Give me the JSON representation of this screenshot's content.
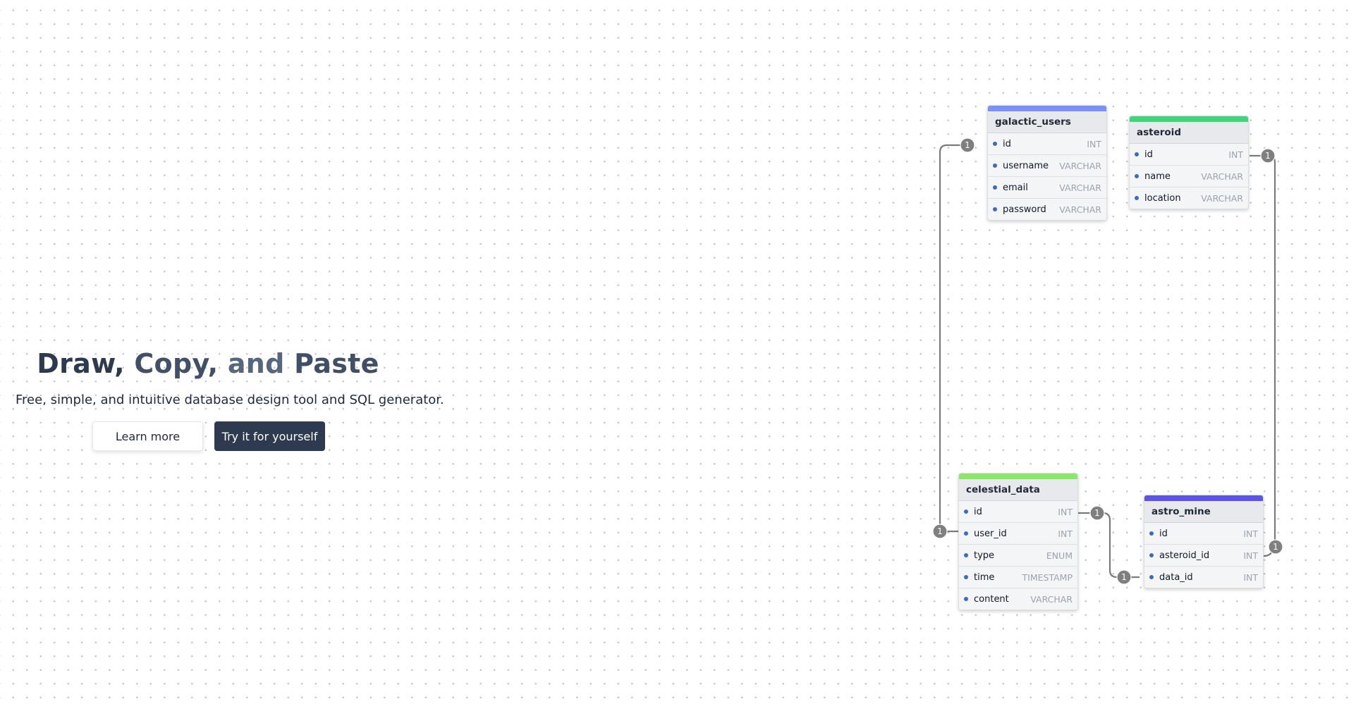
{
  "hero": {
    "title_words": [
      "Draw,",
      "Copy,",
      "and",
      "Paste"
    ],
    "title_colors": [
      "#2b3a4e",
      "#3f5068",
      "#56667c",
      "#3f4f66"
    ],
    "subtitle": "Free, simple, and intuitive database design tool and SQL generator.",
    "learn_more_label": "Learn more",
    "try_label": "Try it for yourself"
  },
  "tables": {
    "galactic_users": {
      "name": "galactic_users",
      "color": "#7b8ff8",
      "fields": [
        {
          "name": "id",
          "type": "INT"
        },
        {
          "name": "username",
          "type": "VARCHAR"
        },
        {
          "name": "email",
          "type": "VARCHAR"
        },
        {
          "name": "password",
          "type": "VARCHAR"
        }
      ]
    },
    "asteroid": {
      "name": "asteroid",
      "color": "#3ed67a",
      "fields": [
        {
          "name": "id",
          "type": "INT"
        },
        {
          "name": "name",
          "type": "VARCHAR"
        },
        {
          "name": "location",
          "type": "VARCHAR"
        }
      ]
    },
    "celestial_data": {
      "name": "celestial_data",
      "color": "#8de56c",
      "fields": [
        {
          "name": "id",
          "type": "INT"
        },
        {
          "name": "user_id",
          "type": "INT"
        },
        {
          "name": "type",
          "type": "ENUM"
        },
        {
          "name": "time",
          "type": "TIMESTAMP"
        },
        {
          "name": "content",
          "type": "VARCHAR"
        }
      ]
    },
    "astro_mine": {
      "name": "astro_mine",
      "color": "#5b53ea",
      "fields": [
        {
          "name": "id",
          "type": "INT"
        },
        {
          "name": "asteroid_id",
          "type": "INT"
        },
        {
          "name": "data_id",
          "type": "INT"
        }
      ]
    }
  },
  "relationship_labels": {
    "users_id": "1",
    "celestial_user_id": "1",
    "asteroid_id": "1",
    "mine_asteroid_id": "1",
    "celestial_id": "1",
    "mine_data_id": "1"
  }
}
